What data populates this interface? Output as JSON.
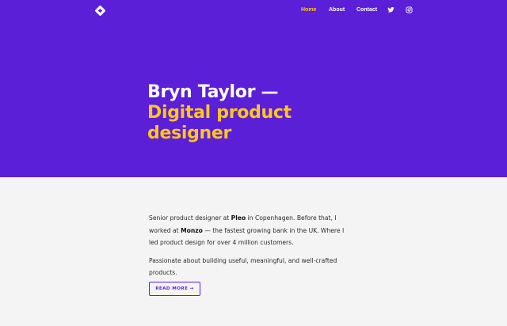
{
  "header": {
    "logo_icon": "diamond-logo-icon",
    "nav": {
      "home": "Home",
      "about": "About",
      "contact": "Contact",
      "twitter_icon": "twitter-icon",
      "instagram_icon": "instagram-icon"
    }
  },
  "hero": {
    "title_line1": "Bryn Taylor —",
    "title_line2": "Digital product designer"
  },
  "intro": {
    "p1_part1": "Senior product designer at ",
    "p1_pleo": "Pleo",
    "p1_part2": " in Copenhagen. Before that, I worked at ",
    "p1_monzo": "Monzo",
    "p1_part3": " — the fastest growing bank in the UK. Where I led product design for over 4 million customers.",
    "p2": "Passionate about building useful, meaningful, and well-crafted products."
  },
  "cta": {
    "read_more_label": "READ MORE →"
  },
  "colors": {
    "brand_purple": "#5b1fd8",
    "accent_yellow": "#ffc51f",
    "background": "#f4f4f4"
  }
}
